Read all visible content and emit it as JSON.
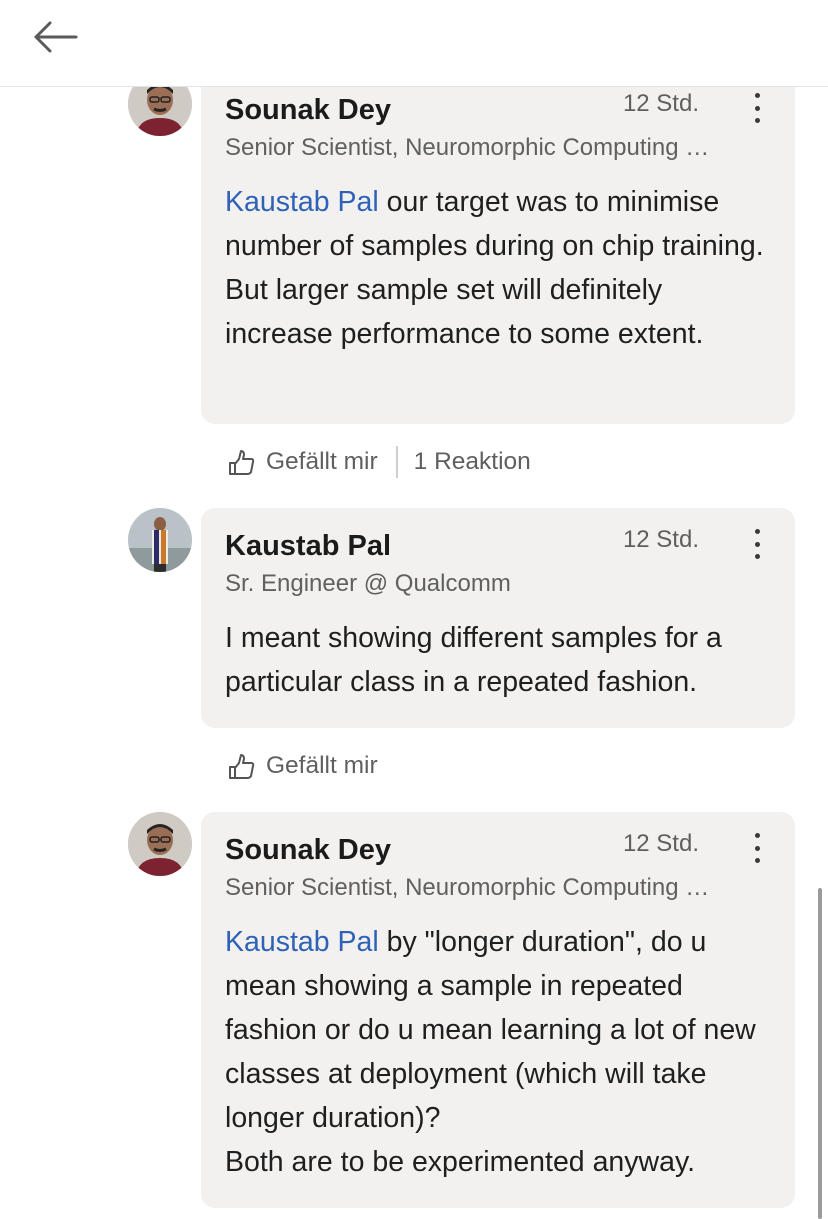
{
  "header": {
    "back_icon": "arrow-left-icon"
  },
  "comments": [
    {
      "author": "Sounak Dey",
      "time": "12 Std.",
      "subtitle": "Senior Scientist, Neuromorphic Computing …",
      "mention": "Kaustab Pal",
      "text": " our target was to minimise number of samples during on chip training. But larger sample set will definitely increase performance to some extent.",
      "like_label": "Gefällt mir",
      "reactions": "1 Reaktion"
    },
    {
      "author": "Kaustab Pal",
      "time": "12 Std.",
      "subtitle": "Sr. Engineer @ Qualcomm",
      "text": "I meant showing different samples for a particular class in a repeated fashion.",
      "like_label": "Gefällt mir"
    },
    {
      "author": "Sounak Dey",
      "time": "12 Std.",
      "subtitle": "Senior Scientist, Neuromorphic Computing …",
      "mention": "Kaustab Pal",
      "text": " by \"longer duration\", do u mean showing a sample in repeated fashion or do u mean learning a lot of new classes at deployment (which will take longer duration)?",
      "text2": "Both are to be experimented anyway."
    }
  ]
}
